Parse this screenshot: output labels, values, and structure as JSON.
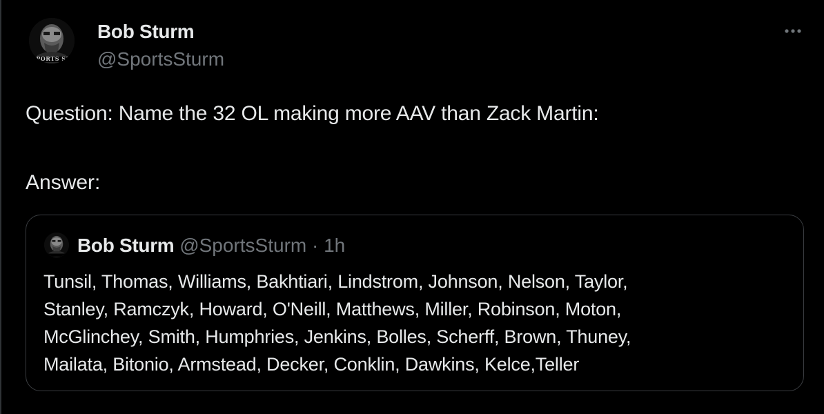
{
  "tweet": {
    "author": {
      "name": "Bob Sturm",
      "handle": "@SportsSturm",
      "avatar_text": "SPORTS STURM"
    },
    "more_icon": "ellipsis-horizontal-icon",
    "text_line1": "Question: Name the 32 OL making more AAV than Zack Martin:",
    "text_line2": "Answer:"
  },
  "quote": {
    "author": {
      "name": "Bob Sturm",
      "handle": "@SportsSturm",
      "separator": "·",
      "time": "1h"
    },
    "lines": [
      "Tunsil, Thomas, Williams, Bakhtiari, Lindstrom, Johnson, Nelson, Taylor,",
      "Stanley, Ramczyk, Howard, O'Neill, Matthews, Miller, Robinson, Moton,",
      "McGlinchey, Smith, Humphries, Jenkins, Bolles, Scherff, Brown, Thuney,",
      "Mailata, Bitonio, Armstead, Decker, Conklin, Dawkins, Kelce,Teller"
    ]
  },
  "colors": {
    "background": "#000000",
    "text_primary": "#e7e9ea",
    "text_secondary": "#71767b",
    "border": "#3a3d41"
  }
}
